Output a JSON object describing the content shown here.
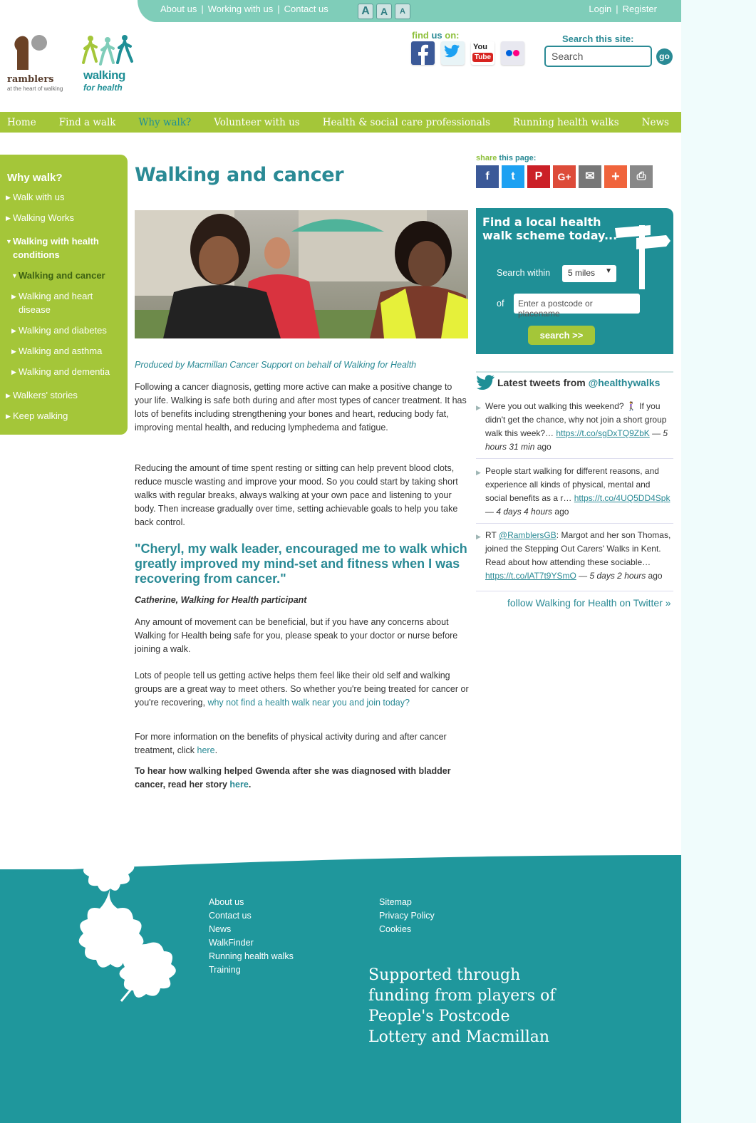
{
  "topbar": {
    "about": "About us",
    "working": "Working with us",
    "contact": "Contact us",
    "sep": "|",
    "font_sizes": [
      "A",
      "A",
      "A"
    ],
    "login": "Login",
    "register": "Register"
  },
  "header": {
    "ramblers_name": "ramblers",
    "ramblers_tag": "at the heart of walking",
    "wfh_line1": "walking",
    "wfh_line2": "for health",
    "findus_prefix": "find",
    "findus_mid": "us",
    "findus_suffix": "on:",
    "social": [
      "facebook",
      "twitter",
      "youtube",
      "flickr"
    ],
    "search_label": "Search this site:",
    "search_placeholder": "Search",
    "go_label": "go"
  },
  "nav": [
    "Home",
    "Find a walk",
    "Why walk?",
    "Volunteer with us",
    "Health & social care professionals",
    "Running health walks",
    "News"
  ],
  "sidebar": {
    "title": "Why walk?",
    "items": [
      "Walk with us",
      "Walking Works",
      "Walking with health conditions",
      "Walking and cancer",
      "Walking and heart disease",
      "Walking and diabetes",
      "Walking and asthma",
      "Walking and dementia",
      "Walkers' stories",
      "Keep walking"
    ]
  },
  "main": {
    "title": "Walking and cancer",
    "byline": "Produced by Macmillan Cancer Support on behalf of Walking for Health",
    "p1": "Following a cancer diagnosis, getting more active can make a positive change to your life.  Walking is safe both during and after most types of cancer treatment. It has lots of benefits including strengthening your bones and heart, reducing body fat, improving mental health, and reducing lymphedema and fatigue.",
    "p2": "Reducing the amount of time spent resting or sitting can help prevent blood clots, reduce muscle wasting and improve your mood. So you could start by taking short walks with regular breaks, always walking at your own pace and listening to your body. Then increase gradually over time, setting achievable goals to help you take back control.",
    "quote": "\"Cheryl, my walk leader, encouraged me to walk which greatly improved my mind-set and fitness when I was recovering from cancer.\"",
    "quote_by": "Catherine, Walking for Health participant",
    "p3": "Any amount of movement can be beneficial, but if you have any concerns about Walking for Health being safe for you, please speak to your doctor or nurse before joining a walk.",
    "p4_text": "Lots of people tell us getting active helps them feel like their old self and walking groups are a great way to meet others. So whether you're being treated for cancer or you're recovering, ",
    "p4_link": "why not find a health walk near you and join today?",
    "p5_text": "For more information on the benefits of physical activity during and after cancer treatment, click ",
    "p5_link": "here",
    "p5_end": ".",
    "p6_text": "To hear how walking helped Gwenda after she was diagnosed with bladder cancer, read her story ",
    "p6_link": "here",
    "p6_end": "."
  },
  "share": {
    "label_a": "share",
    "label_b": "this",
    "label_c": "page:",
    "buttons": [
      "f",
      "t",
      "P",
      "G+",
      "✉",
      "+",
      "⎙"
    ]
  },
  "findpanel": {
    "title": "Find a local health walk scheme today...",
    "search_within": "Search within",
    "distance": "5 miles",
    "of": "of",
    "placeholder": "Enter a postcode or placename",
    "button": "search >>"
  },
  "tweets": {
    "heading": "Latest tweets from",
    "handle": "@healthywalks",
    "items": [
      {
        "text": "Were you out walking this weekend? 🚶‍♀️ If you didn't get the chance, why not join a short group walk this week?… ",
        "link": "https://t.co/sgDxTQ9ZbK",
        "time": " — 5 hours 31 min",
        "ago": " ago"
      },
      {
        "text": "People start walking for different reasons, and experience all kinds of physical, mental and social benefits as a r… ",
        "link": "https://t.co/4UQ5DD4Spk",
        "time": " — 4 days 4 hours",
        "ago": " ago"
      },
      {
        "pre": "RT ",
        "mention": "@RamblersGB",
        "text": ": Margot and her son Thomas, joined the Stepping Out Carers' Walks in Kent. Read about how attending these sociable… ",
        "link": "https://t.co/lAT7t9YSmO",
        "time": " — 5 days 2 hours",
        "ago": " ago"
      }
    ],
    "follow": "follow Walking for Health on Twitter »"
  },
  "footer": {
    "col1": [
      "About us",
      "Contact us",
      "News",
      "WalkFinder",
      "Running health walks",
      "Training"
    ],
    "col2": [
      "Sitemap",
      "Privacy Policy",
      "Cookies"
    ],
    "supported": "Supported through funding from players of People's Postcode Lottery and Macmillan"
  },
  "colors": {
    "teal": "#1f8f96",
    "green": "#a4c639",
    "topbar": "#7fcdb9"
  }
}
